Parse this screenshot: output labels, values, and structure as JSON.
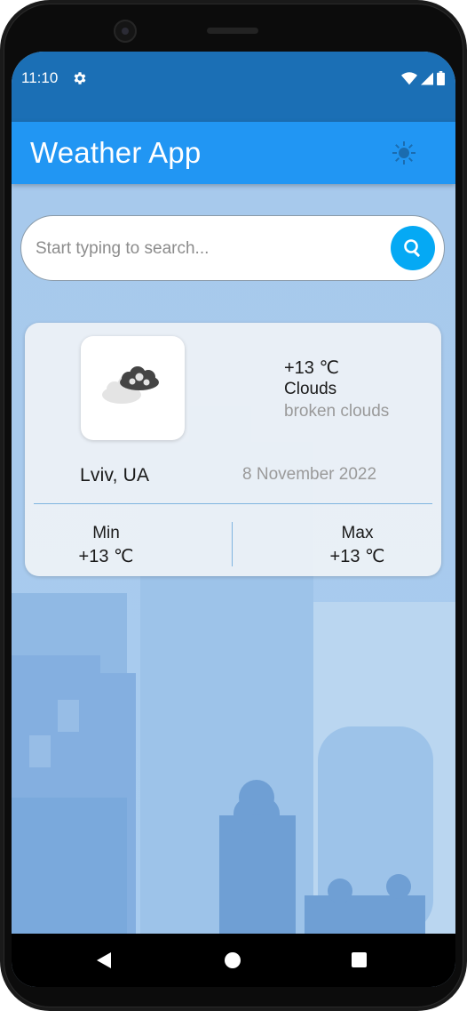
{
  "status_bar": {
    "time": "11:10",
    "settings_icon": "gear-icon",
    "wifi_icon": "wifi-icon",
    "signal_icon": "signal-icon",
    "battery_icon": "battery-icon"
  },
  "app_bar": {
    "title": "Weather App",
    "theme_icon": "sun-icon"
  },
  "search": {
    "placeholder": "Start typing to search...",
    "value": "",
    "button_icon": "search-icon"
  },
  "weather_card": {
    "icon": "broken-clouds-icon",
    "temperature": "+13 ℃",
    "condition": "Clouds",
    "description": "broken clouds",
    "city": "Lviv, UA",
    "date": "8 November 2022",
    "min_label": "Min",
    "min_value": "+13 ℃",
    "max_label": "Max",
    "max_value": "+13 ℃"
  },
  "nav_bar": {
    "back_icon": "back-triangle-icon",
    "home_icon": "home-circle-icon",
    "recents_icon": "recents-square-icon"
  },
  "colors": {
    "status_bar": "#1b6fb5",
    "app_bar": "#2196f3",
    "background": "#a9ccee",
    "search_button": "#05a9f4",
    "card": "#eef2f6",
    "divider": "#7fb4e0"
  }
}
